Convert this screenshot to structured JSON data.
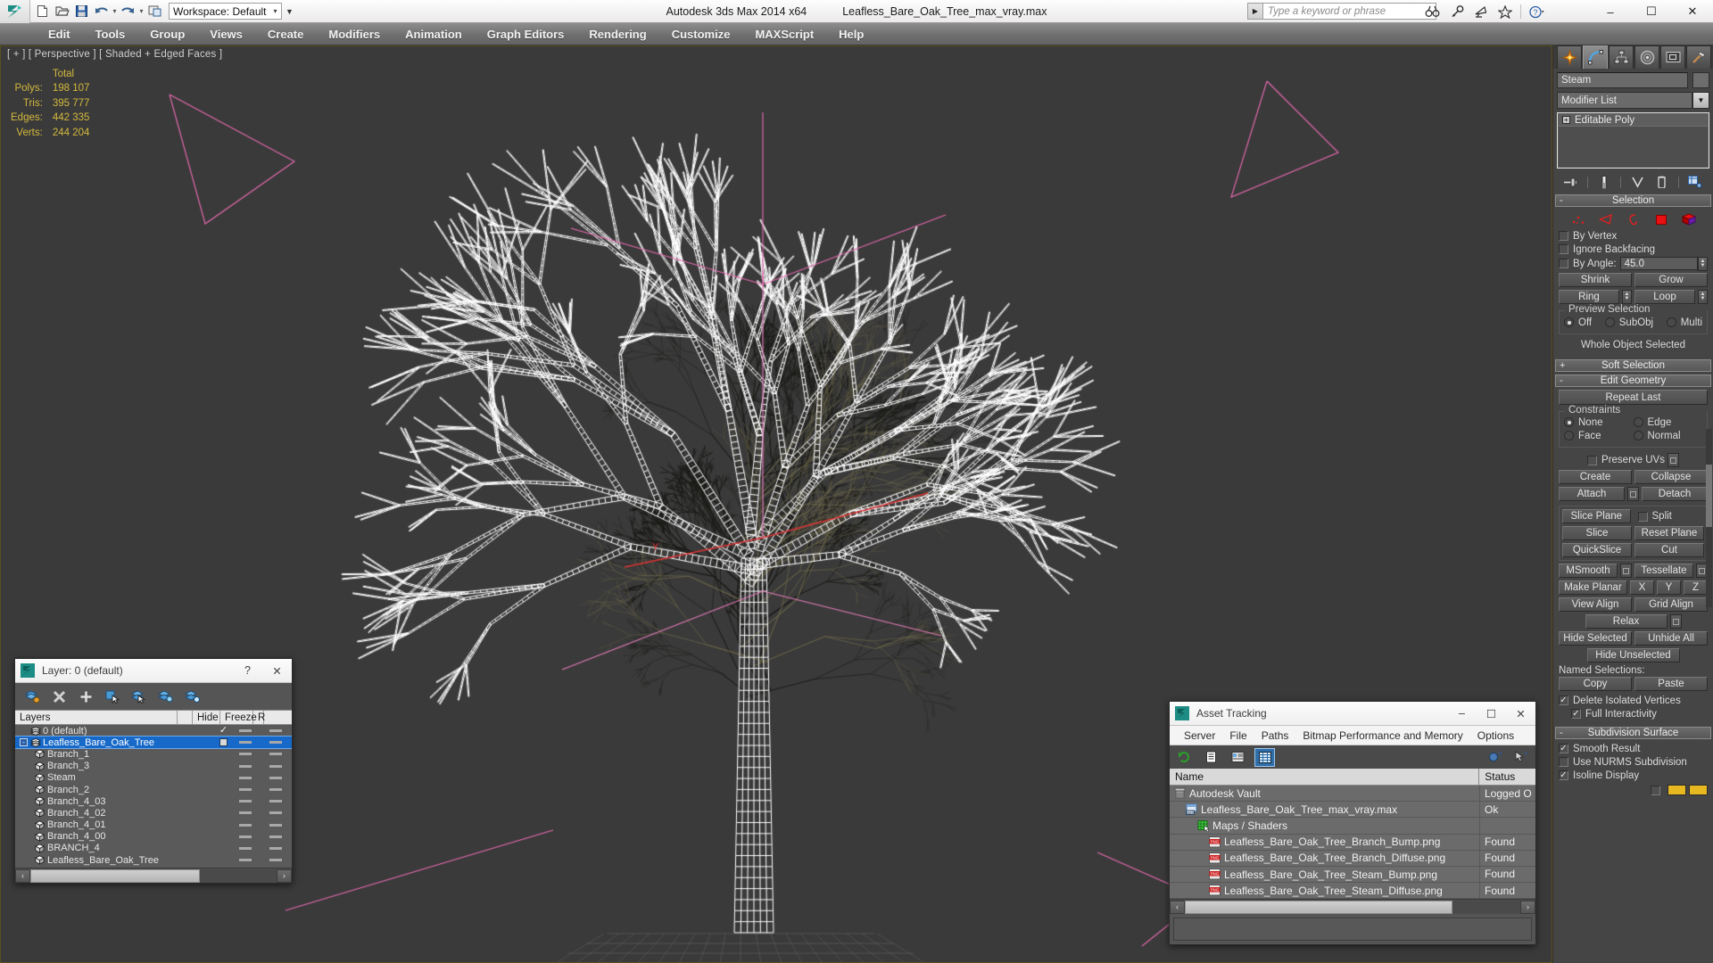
{
  "titlebar": {
    "app_title": "Autodesk 3ds Max  2014 x64",
    "file_name": "Leafless_Bare_Oak_Tree_max_vray.max",
    "workspace": "Workspace: Default",
    "search_placeholder": "Type a keyword or phrase",
    "quick_access": [
      {
        "name": "new-file-icon",
        "label": "New"
      },
      {
        "name": "open-file-icon",
        "label": "Open"
      },
      {
        "name": "save-file-icon",
        "label": "Save"
      },
      {
        "name": "undo-icon",
        "label": "Undo"
      },
      {
        "name": "redo-icon",
        "label": "Redo"
      },
      {
        "name": "project-folder-icon",
        "label": "Set Project Folder"
      }
    ],
    "help_icons": [
      {
        "name": "search-binoculars-icon"
      },
      {
        "name": "key-icon"
      },
      {
        "name": "satellite-dish-icon"
      },
      {
        "name": "star-favorites-icon"
      },
      {
        "name": "help-question-icon"
      }
    ],
    "window_buttons": {
      "minimize": "–",
      "maximize": "☐",
      "close": "✕"
    }
  },
  "menubar": {
    "items": [
      "Edit",
      "Tools",
      "Group",
      "Views",
      "Create",
      "Modifiers",
      "Animation",
      "Graph Editors",
      "Rendering",
      "Customize",
      "MAXScript",
      "Help"
    ]
  },
  "viewport": {
    "label": "[ + ] [ Perspective ] [ Shaded + Edged Faces ]",
    "stats": {
      "column_header": "Total",
      "rows": [
        {
          "label": "Polys:",
          "value": "198 107"
        },
        {
          "label": "Tris:",
          "value": "395 777"
        },
        {
          "label": "Edges:",
          "value": "442 335"
        },
        {
          "label": "Verts:",
          "value": "244 204"
        }
      ]
    }
  },
  "layer_dialog": {
    "title": "Layer: 0 (default)",
    "help_btn": "?",
    "close_btn": "✕",
    "toolbar": [
      {
        "name": "create-new-layer-icon"
      },
      {
        "name": "delete-highlighted-layers-icon"
      },
      {
        "name": "add-selected-objects-icon"
      },
      {
        "name": "select-highlighted-objects-icon"
      },
      {
        "name": "highlight-selected-objects-icon"
      },
      {
        "name": "hide-unhide-layers-icon"
      }
    ],
    "columns": [
      "Layers",
      "",
      "Hide",
      "Freeze",
      "R"
    ],
    "rows": [
      {
        "name": "0 (default)",
        "indent": 0,
        "type": "layer",
        "selected": false,
        "current": true,
        "hide": "—",
        "freeze": "—"
      },
      {
        "name": "Leafless_Bare_Oak_Tree",
        "indent": 0,
        "type": "layer",
        "selected": true,
        "current": false,
        "hide": "—",
        "freeze": "—"
      },
      {
        "name": "Branch_1",
        "indent": 1,
        "type": "object",
        "selected": false,
        "current": false,
        "hide": "—",
        "freeze": "—"
      },
      {
        "name": "Branch_3",
        "indent": 1,
        "type": "object",
        "selected": false,
        "current": false,
        "hide": "—",
        "freeze": "—"
      },
      {
        "name": "Steam",
        "indent": 1,
        "type": "object",
        "selected": false,
        "current": false,
        "hide": "—",
        "freeze": "—"
      },
      {
        "name": "Branch_2",
        "indent": 1,
        "type": "object",
        "selected": false,
        "current": false,
        "hide": "—",
        "freeze": "—"
      },
      {
        "name": "Branch_4_03",
        "indent": 1,
        "type": "object",
        "selected": false,
        "current": false,
        "hide": "—",
        "freeze": "—"
      },
      {
        "name": "Branch_4_02",
        "indent": 1,
        "type": "object",
        "selected": false,
        "current": false,
        "hide": "—",
        "freeze": "—"
      },
      {
        "name": "Branch_4_01",
        "indent": 1,
        "type": "object",
        "selected": false,
        "current": false,
        "hide": "—",
        "freeze": "—"
      },
      {
        "name": "Branch_4_00",
        "indent": 1,
        "type": "object",
        "selected": false,
        "current": false,
        "hide": "—",
        "freeze": "—"
      },
      {
        "name": "BRANCH_4",
        "indent": 1,
        "type": "object",
        "selected": false,
        "current": false,
        "hide": "—",
        "freeze": "—"
      },
      {
        "name": "Leafless_Bare_Oak_Tree",
        "indent": 1,
        "type": "object",
        "selected": false,
        "current": false,
        "hide": "—",
        "freeze": "—"
      }
    ],
    "scroll_left": "‹",
    "scroll_right": "›"
  },
  "asset_tracking": {
    "title": "Asset Tracking",
    "window_buttons": {
      "minimize": "–",
      "maximize": "☐",
      "close": "✕"
    },
    "menu": [
      "Server",
      "File",
      "Paths",
      "Bitmap Performance and Memory",
      "Options"
    ],
    "toolbar": [
      {
        "name": "refresh-icon",
        "active": false
      },
      {
        "name": "list-view-icon",
        "active": false
      },
      {
        "name": "detail-view-icon",
        "active": false
      },
      {
        "name": "table-view-icon",
        "active": true
      }
    ],
    "toolbar_right": [
      {
        "name": "vault-help-icon"
      },
      {
        "name": "help-arrow-icon"
      }
    ],
    "columns": [
      "Name",
      "Status"
    ],
    "rows": [
      {
        "name": "Autodesk Vault",
        "status": "Logged O",
        "indent": 0,
        "icon": "vault-icon"
      },
      {
        "name": "Leafless_Bare_Oak_Tree_max_vray.max",
        "status": "Ok",
        "indent": 1,
        "icon": "max-file-icon"
      },
      {
        "name": "Maps / Shaders",
        "status": "",
        "indent": 2,
        "icon": "maps-shaders-icon"
      },
      {
        "name": "Leafless_Bare_Oak_Tree_Branch_Bump.png",
        "status": "Found",
        "indent": 3,
        "icon": "png-icon"
      },
      {
        "name": "Leafless_Bare_Oak_Tree_Branch_Diffuse.png",
        "status": "Found",
        "indent": 3,
        "icon": "png-icon"
      },
      {
        "name": "Leafless_Bare_Oak_Tree_Steam_Bump.png",
        "status": "Found",
        "indent": 3,
        "icon": "png-icon"
      },
      {
        "name": "Leafless_Bare_Oak_Tree_Steam_Diffuse.png",
        "status": "Found",
        "indent": 3,
        "icon": "png-icon"
      }
    ],
    "scroll_left": "‹",
    "scroll_right": "›"
  },
  "command_panel": {
    "tabs": [
      {
        "name": "create-tab",
        "icon": "star-burst-icon",
        "active": false
      },
      {
        "name": "modify-tab",
        "icon": "curve-icon",
        "active": true
      },
      {
        "name": "hierarchy-tab",
        "icon": "hierarchy-icon",
        "active": false
      },
      {
        "name": "motion-tab",
        "icon": "motion-wheel-icon",
        "active": false
      },
      {
        "name": "display-tab",
        "icon": "display-monitor-icon",
        "active": false
      },
      {
        "name": "utilities-tab",
        "icon": "hammer-icon",
        "active": false
      }
    ],
    "object_name": "Steam",
    "modifier_list_label": "Modifier List",
    "stack": [
      {
        "label": "Editable Poly",
        "expand": "+"
      }
    ],
    "stack_tools": [
      {
        "name": "pin-stack-icon"
      },
      {
        "name": "show-end-result-icon"
      },
      {
        "name": "make-unique-icon"
      },
      {
        "name": "remove-modifier-icon"
      },
      {
        "name": "configure-modifier-sets-icon"
      }
    ],
    "rollouts": {
      "selection": {
        "title": "Selection",
        "state": "-",
        "sub_levels": [
          {
            "name": "vertex-subobject-icon"
          },
          {
            "name": "edge-subobject-icon"
          },
          {
            "name": "border-subobject-icon"
          },
          {
            "name": "polygon-subobject-icon"
          },
          {
            "name": "element-subobject-icon"
          }
        ],
        "by_vertex": {
          "label": "By Vertex",
          "checked": false
        },
        "ignore_backfacing": {
          "label": "Ignore Backfacing",
          "checked": false
        },
        "by_angle": {
          "label": "By Angle:",
          "checked": false,
          "value": "45.0"
        },
        "shrink": "Shrink",
        "grow": "Grow",
        "ring": "Ring",
        "loop": "Loop",
        "preview_selection": {
          "label": "Preview Selection",
          "options": [
            {
              "label": "Off",
              "selected": true
            },
            {
              "label": "SubObj",
              "selected": false
            },
            {
              "label": "Multi",
              "selected": false
            }
          ]
        },
        "status": "Whole Object Selected"
      },
      "soft_selection": {
        "title": "Soft Selection",
        "state": "+"
      },
      "edit_geometry": {
        "title": "Edit Geometry",
        "state": "-",
        "repeat_last": "Repeat Last",
        "constraints": {
          "label": "Constraints",
          "options": [
            {
              "label": "None",
              "selected": true
            },
            {
              "label": "Edge",
              "selected": false
            },
            {
              "label": "Face",
              "selected": false
            },
            {
              "label": "Normal",
              "selected": false
            }
          ]
        },
        "preserve_uvs": {
          "label": "Preserve UVs",
          "checked": false
        },
        "create": "Create",
        "collapse": "Collapse",
        "attach": "Attach",
        "detach": "Detach",
        "slice_plane": "Slice Plane",
        "split": {
          "label": "Split",
          "checked": false
        },
        "slice": "Slice",
        "reset_plane": "Reset Plane",
        "quickslice": "QuickSlice",
        "cut": "Cut",
        "msmooth": "MSmooth",
        "tessellate": "Tessellate",
        "make_planar": "Make Planar",
        "axis_x": "X",
        "axis_y": "Y",
        "axis_z": "Z",
        "view_align": "View Align",
        "grid_align": "Grid Align",
        "relax": "Relax",
        "hide_selected": "Hide Selected",
        "unhide_all": "Unhide All",
        "hide_unselected": "Hide Unselected",
        "named_selections_label": "Named Selections:",
        "copy": "Copy",
        "paste": "Paste",
        "delete_isolated_vertices": {
          "label": "Delete Isolated Vertices",
          "checked": true
        },
        "full_interactivity": {
          "label": "Full Interactivity",
          "checked": true
        }
      },
      "subdivision_surface": {
        "title": "Subdivision Surface",
        "state": "-",
        "smooth_result": {
          "label": "Smooth Result",
          "checked": true
        },
        "use_nurms": {
          "label": "Use NURMS Subdivision",
          "checked": false
        },
        "isoline_display": {
          "label": "Isoline Display",
          "checked": true
        }
      }
    }
  },
  "colors": {
    "accent_blue": "#1669c8",
    "stats_yellow": "#d4b93c",
    "viewport_bg": "#3a3a3a",
    "panel_bg": "#454545",
    "sub_object_red": "#e02020"
  }
}
